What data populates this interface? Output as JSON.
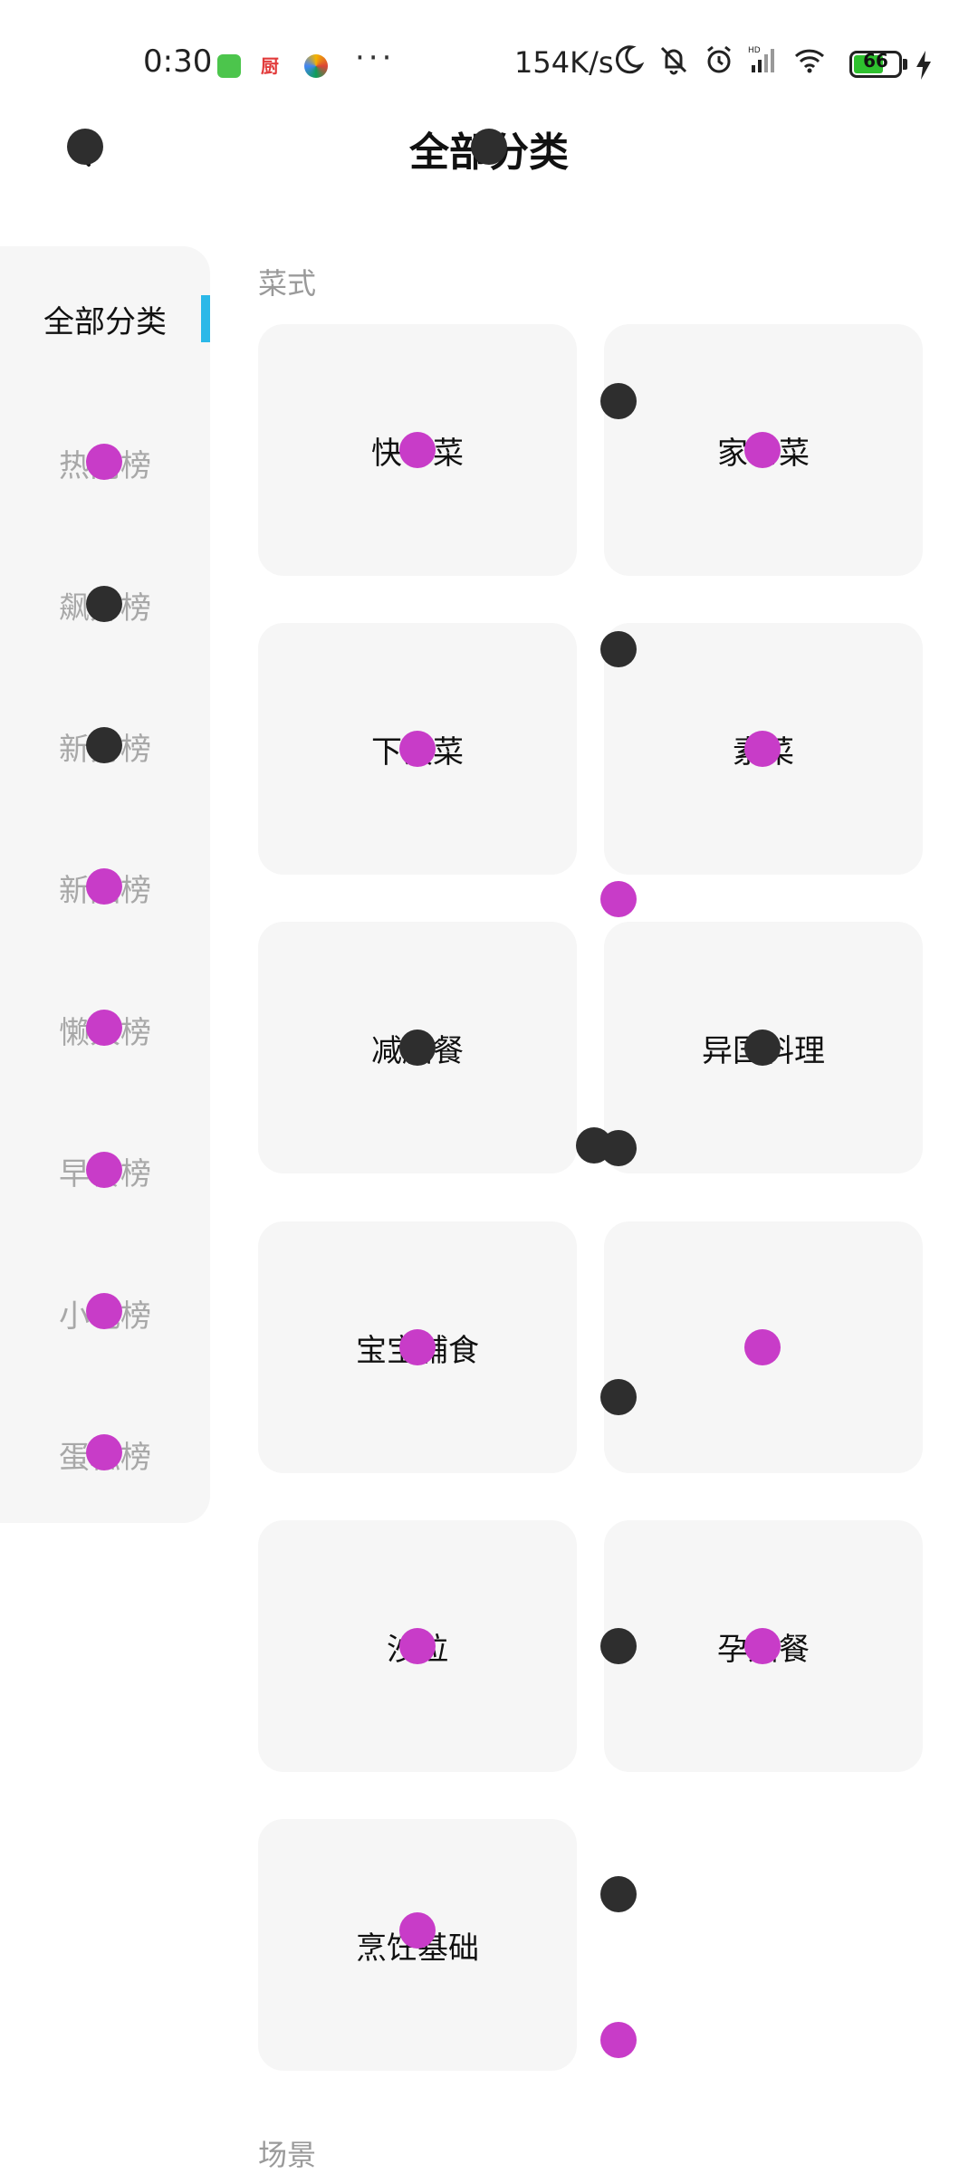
{
  "status_bar": {
    "time": "0:30",
    "app_icon_2_text": "厨",
    "more": "···",
    "net_speed": "154K/s",
    "battery_level": "66"
  },
  "header": {
    "title": "全部分类"
  },
  "sidebar": {
    "items": [
      {
        "label": "全部分类",
        "active": true
      },
      {
        "label": "热门榜",
        "active": false
      },
      {
        "label": "飙升榜",
        "active": false
      },
      {
        "label": "新秀榜",
        "active": false
      },
      {
        "label": "新品榜",
        "active": false
      },
      {
        "label": "懒人榜",
        "active": false
      },
      {
        "label": "早餐榜",
        "active": false
      },
      {
        "label": "小吃榜",
        "active": false
      },
      {
        "label": "蛋糕榜",
        "active": false
      }
    ]
  },
  "sections": [
    {
      "title": "菜式",
      "cards": [
        {
          "label": "快手菜"
        },
        {
          "label": "家常菜"
        },
        {
          "label": "下饭菜"
        },
        {
          "label": "素菜"
        },
        {
          "label": "减脂餐"
        },
        {
          "label": "异国料理"
        },
        {
          "label": "宝宝辅食"
        },
        {
          "label": ""
        },
        {
          "label": "沙拉"
        },
        {
          "label": "孕妇餐"
        },
        {
          "label": "烹饪基础"
        }
      ]
    },
    {
      "title": "场景",
      "cards": []
    }
  ],
  "colors": {
    "accent": "#2bb8e8",
    "card_bg": "#f6f6f6",
    "muted_text": "#a8a8a8",
    "dot_dark": "#2e2e2e",
    "dot_magenta": "#c83cc8"
  }
}
